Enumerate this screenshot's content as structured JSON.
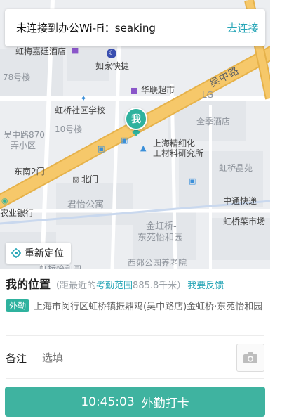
{
  "wifi": {
    "message": "未连接到办公Wi-Fi：seaking",
    "action_label": "去连接"
  },
  "map": {
    "labels": {
      "hongmei_hotel": "虹梅嘉廷酒店",
      "home_inn": "如家快捷",
      "building_78": "78号楼",
      "hualian": "华联超市",
      "lg": "LG",
      "wuzhong_road": "吴中路",
      "hongqiao_school": "虹桥社区学校",
      "building_10": "10号楼",
      "quanji_hotel": "全季酒店",
      "wuzhong_870": "吴中路870",
      "nong_xiaoqu": "弄小区",
      "precision_inst": "上海精细化",
      "precision_inst2": "工材料研究所",
      "dongnan_gate": "东南2门",
      "north_gate": "北门",
      "hongqiao_jingyuan": "虹桥晶苑",
      "junyi_apartment": "君怡公寓",
      "zhongtong": "中通快递",
      "bank": "农业银行",
      "jinhongqiao": "金虹桥-",
      "dongyuan": "东苑怡和园",
      "hongqiao_market": "虹桥菜市场",
      "xijiao_park": "西郊公园养老院",
      "hongqiao_bottom": "虹桥怡和园",
      "me": "我"
    },
    "icons": [
      "shop-icon",
      "moon-icon",
      "bus-stop-icon",
      "school-icon",
      "metro-icon",
      "pin-icon",
      "bank-icon"
    ]
  },
  "relocate_label": "重新定位",
  "location": {
    "title": "我的位置",
    "paren_open": "（距最近的",
    "range_label": "考勤范围",
    "distance": "885.8千米）",
    "feedback_label": "我要反馈",
    "badge": "外勤",
    "address": "上海市闵行区虹桥镇振鼎鸡(吴中路店)金虹桥·东苑怡和园"
  },
  "note": {
    "label": "备注",
    "placeholder": "选填"
  },
  "clock_in": {
    "time": "10:45:03",
    "label": "外勤打卡"
  },
  "colors": {
    "accent": "#28a6b7",
    "button": "#3fb3a0",
    "marker": "#2fb29e",
    "road": "#f6c86a"
  }
}
